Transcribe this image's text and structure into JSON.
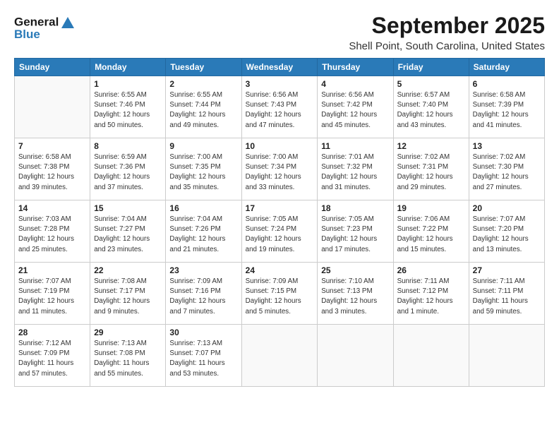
{
  "logo": {
    "line1": "General",
    "line2": "Blue"
  },
  "title": "September 2025",
  "location": "Shell Point, South Carolina, United States",
  "days_of_week": [
    "Sunday",
    "Monday",
    "Tuesday",
    "Wednesday",
    "Thursday",
    "Friday",
    "Saturday"
  ],
  "weeks": [
    [
      {
        "num": "",
        "info": ""
      },
      {
        "num": "1",
        "info": "Sunrise: 6:55 AM\nSunset: 7:46 PM\nDaylight: 12 hours\nand 50 minutes."
      },
      {
        "num": "2",
        "info": "Sunrise: 6:55 AM\nSunset: 7:44 PM\nDaylight: 12 hours\nand 49 minutes."
      },
      {
        "num": "3",
        "info": "Sunrise: 6:56 AM\nSunset: 7:43 PM\nDaylight: 12 hours\nand 47 minutes."
      },
      {
        "num": "4",
        "info": "Sunrise: 6:56 AM\nSunset: 7:42 PM\nDaylight: 12 hours\nand 45 minutes."
      },
      {
        "num": "5",
        "info": "Sunrise: 6:57 AM\nSunset: 7:40 PM\nDaylight: 12 hours\nand 43 minutes."
      },
      {
        "num": "6",
        "info": "Sunrise: 6:58 AM\nSunset: 7:39 PM\nDaylight: 12 hours\nand 41 minutes."
      }
    ],
    [
      {
        "num": "7",
        "info": "Sunrise: 6:58 AM\nSunset: 7:38 PM\nDaylight: 12 hours\nand 39 minutes."
      },
      {
        "num": "8",
        "info": "Sunrise: 6:59 AM\nSunset: 7:36 PM\nDaylight: 12 hours\nand 37 minutes."
      },
      {
        "num": "9",
        "info": "Sunrise: 7:00 AM\nSunset: 7:35 PM\nDaylight: 12 hours\nand 35 minutes."
      },
      {
        "num": "10",
        "info": "Sunrise: 7:00 AM\nSunset: 7:34 PM\nDaylight: 12 hours\nand 33 minutes."
      },
      {
        "num": "11",
        "info": "Sunrise: 7:01 AM\nSunset: 7:32 PM\nDaylight: 12 hours\nand 31 minutes."
      },
      {
        "num": "12",
        "info": "Sunrise: 7:02 AM\nSunset: 7:31 PM\nDaylight: 12 hours\nand 29 minutes."
      },
      {
        "num": "13",
        "info": "Sunrise: 7:02 AM\nSunset: 7:30 PM\nDaylight: 12 hours\nand 27 minutes."
      }
    ],
    [
      {
        "num": "14",
        "info": "Sunrise: 7:03 AM\nSunset: 7:28 PM\nDaylight: 12 hours\nand 25 minutes."
      },
      {
        "num": "15",
        "info": "Sunrise: 7:04 AM\nSunset: 7:27 PM\nDaylight: 12 hours\nand 23 minutes."
      },
      {
        "num": "16",
        "info": "Sunrise: 7:04 AM\nSunset: 7:26 PM\nDaylight: 12 hours\nand 21 minutes."
      },
      {
        "num": "17",
        "info": "Sunrise: 7:05 AM\nSunset: 7:24 PM\nDaylight: 12 hours\nand 19 minutes."
      },
      {
        "num": "18",
        "info": "Sunrise: 7:05 AM\nSunset: 7:23 PM\nDaylight: 12 hours\nand 17 minutes."
      },
      {
        "num": "19",
        "info": "Sunrise: 7:06 AM\nSunset: 7:22 PM\nDaylight: 12 hours\nand 15 minutes."
      },
      {
        "num": "20",
        "info": "Sunrise: 7:07 AM\nSunset: 7:20 PM\nDaylight: 12 hours\nand 13 minutes."
      }
    ],
    [
      {
        "num": "21",
        "info": "Sunrise: 7:07 AM\nSunset: 7:19 PM\nDaylight: 12 hours\nand 11 minutes."
      },
      {
        "num": "22",
        "info": "Sunrise: 7:08 AM\nSunset: 7:17 PM\nDaylight: 12 hours\nand 9 minutes."
      },
      {
        "num": "23",
        "info": "Sunrise: 7:09 AM\nSunset: 7:16 PM\nDaylight: 12 hours\nand 7 minutes."
      },
      {
        "num": "24",
        "info": "Sunrise: 7:09 AM\nSunset: 7:15 PM\nDaylight: 12 hours\nand 5 minutes."
      },
      {
        "num": "25",
        "info": "Sunrise: 7:10 AM\nSunset: 7:13 PM\nDaylight: 12 hours\nand 3 minutes."
      },
      {
        "num": "26",
        "info": "Sunrise: 7:11 AM\nSunset: 7:12 PM\nDaylight: 12 hours\nand 1 minute."
      },
      {
        "num": "27",
        "info": "Sunrise: 7:11 AM\nSunset: 7:11 PM\nDaylight: 11 hours\nand 59 minutes."
      }
    ],
    [
      {
        "num": "28",
        "info": "Sunrise: 7:12 AM\nSunset: 7:09 PM\nDaylight: 11 hours\nand 57 minutes."
      },
      {
        "num": "29",
        "info": "Sunrise: 7:13 AM\nSunset: 7:08 PM\nDaylight: 11 hours\nand 55 minutes."
      },
      {
        "num": "30",
        "info": "Sunrise: 7:13 AM\nSunset: 7:07 PM\nDaylight: 11 hours\nand 53 minutes."
      },
      {
        "num": "",
        "info": ""
      },
      {
        "num": "",
        "info": ""
      },
      {
        "num": "",
        "info": ""
      },
      {
        "num": "",
        "info": ""
      }
    ]
  ]
}
